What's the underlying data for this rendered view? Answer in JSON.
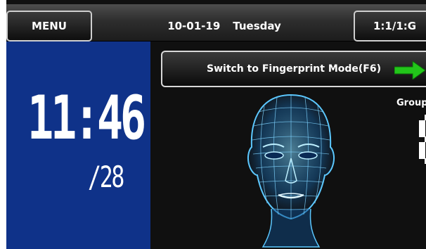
{
  "topbar": {
    "menu_label": "MENU",
    "date": "10-01-19",
    "weekday": "Tuesday",
    "mode_label": "1:1/1:G"
  },
  "clock": {
    "time": "11:46",
    "sub": "/28"
  },
  "main": {
    "switch_label": "Switch to Fingerprint Mode(F6)",
    "group_label": "Group"
  },
  "colors": {
    "clock_panel": "#0f3289",
    "accent_green": "#22c51a",
    "face_glow": "#39b8ff"
  },
  "icons": {
    "arrow": "right-arrow-icon",
    "face": "face-scan-icon"
  }
}
